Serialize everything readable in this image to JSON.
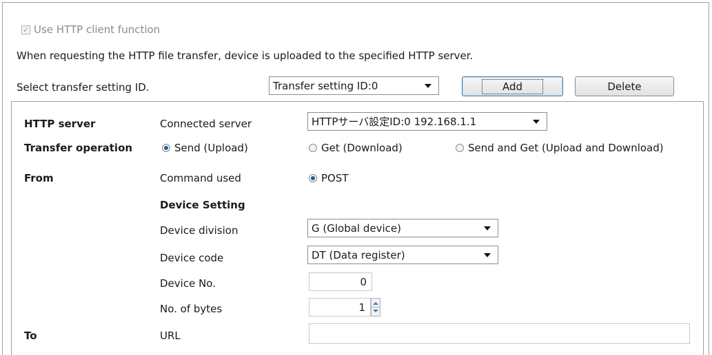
{
  "top": {
    "use_http_label": "Use HTTP client function",
    "use_http_checked": true,
    "description": "When requesting the HTTP file transfer, device is uploaded to the specified HTTP server.",
    "select_label": "Select transfer setting ID.",
    "transfer_setting_value": "Transfer setting ID:0",
    "add_label": "Add",
    "delete_label": "Delete"
  },
  "panel": {
    "http_server": {
      "heading": "HTTP server",
      "label": "Connected server",
      "value": "HTTPサーバ設定ID:0 192.168.1.1"
    },
    "transfer_operation": {
      "heading": "Transfer operation",
      "options": [
        {
          "label": "Send (Upload)",
          "selected": true
        },
        {
          "label": "Get (Download)",
          "selected": false
        },
        {
          "label": "Send and Get (Upload and Download)",
          "selected": false
        }
      ]
    },
    "from": {
      "heading": "From",
      "command_label": "Command used",
      "command_value": "POST",
      "device_setting_heading": "Device Setting",
      "device_division_label": "Device division",
      "device_division_value": "G (Global device)",
      "device_code_label": "Device code",
      "device_code_value": "DT (Data register)",
      "device_no_label": "Device No.",
      "device_no_value": "0",
      "bytes_label": "No. of bytes",
      "bytes_value": "1"
    },
    "to": {
      "heading": "To",
      "url_label": "URL",
      "url_value": ""
    }
  },
  "icons": {
    "checkbox": "checkmark-icon",
    "dropdown": "chevron-down-icon",
    "spin_up": "arrow-up-icon",
    "spin_down": "arrow-down-icon"
  },
  "colors": {
    "radio_selected": "#1f5fa8",
    "focus_border": "#3c7fb1"
  }
}
